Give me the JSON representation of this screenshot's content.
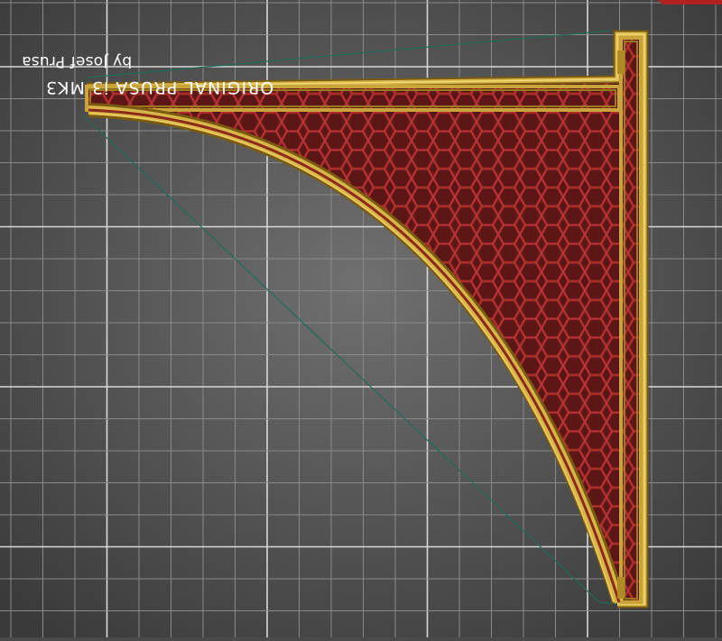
{
  "scene": {
    "bed_text_line1": "by Josef Prusa",
    "bed_text_line2": "ORIGINAL PRUSA i3 MK3",
    "colors": {
      "bed_center": "#6e6e6e",
      "bed_edge": "#3a3a3a",
      "grid_minor": "#8a8a8a",
      "grid_major": "#d8d8d8",
      "model_outline": "#c9a43a",
      "model_infill": "#8b1f1f",
      "travel_line": "#1f6b5a",
      "marker": "#b32020"
    },
    "icons": [
      "bracket-model",
      "bed-grid"
    ]
  }
}
